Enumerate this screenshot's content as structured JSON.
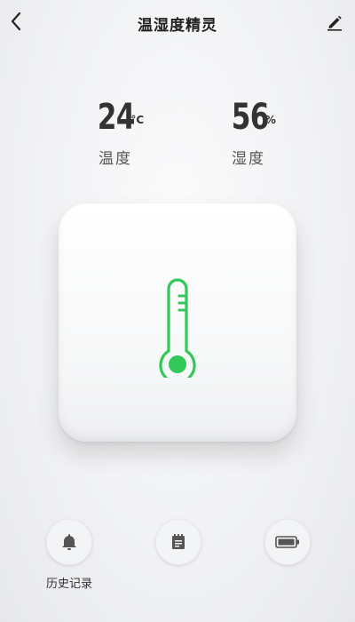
{
  "header": {
    "title": "温湿度精灵",
    "back_icon": "chevron-left-icon",
    "edit_icon": "pencil-icon"
  },
  "readings": {
    "temperature": {
      "value": "24",
      "unit": "°C",
      "label": "温度"
    },
    "humidity": {
      "value": "56",
      "unit": "%",
      "label": "湿度"
    }
  },
  "device": {
    "icon": "thermometer-icon",
    "accent_color": "#34c759"
  },
  "actions": [
    {
      "name": "history",
      "icon": "bell-icon",
      "label": "历史记录"
    },
    {
      "name": "schedule",
      "icon": "calendar-icon"
    },
    {
      "name": "battery",
      "icon": "battery-icon"
    }
  ]
}
